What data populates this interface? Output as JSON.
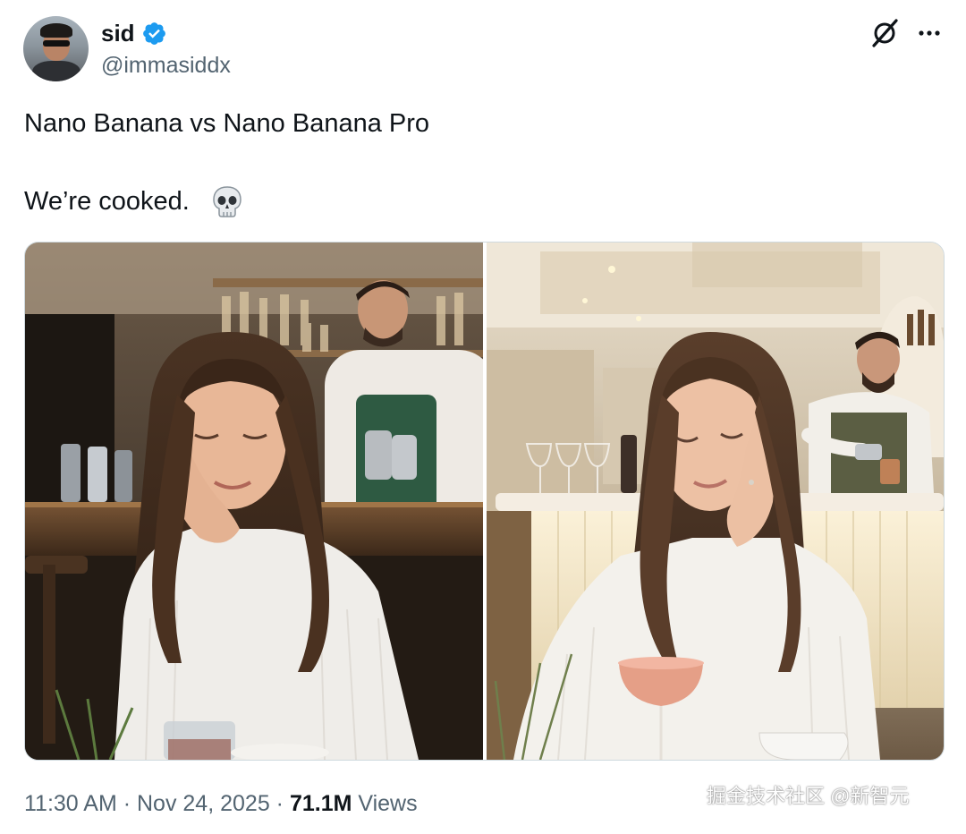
{
  "author": {
    "display_name": "sid",
    "handle": "@immasiddx",
    "verified": true,
    "verified_color": "#1d9bf0"
  },
  "header_icons": [
    "grok-icon",
    "more-options-icon"
  ],
  "tweet": {
    "line1": "Nano Banana vs Nano Banana Pro",
    "line2": "We’re cooked.",
    "emoji": "skull-icon"
  },
  "media": {
    "count": 2,
    "images": [
      {
        "scene": "woman with eyes closed resting chin on hand in cafe with bartender, left image"
      },
      {
        "scene": "woman with eyes closed resting chin on hand in elegant bar with bartender and pink cocktail, right image"
      }
    ]
  },
  "meta": {
    "time": "11:30 AM",
    "separator1": " · ",
    "date": "Nov 24, 2025",
    "separator2": " · ",
    "views_count": "71.1M",
    "views_label": "Views"
  },
  "watermark": "掘金技术社区 @新智元"
}
